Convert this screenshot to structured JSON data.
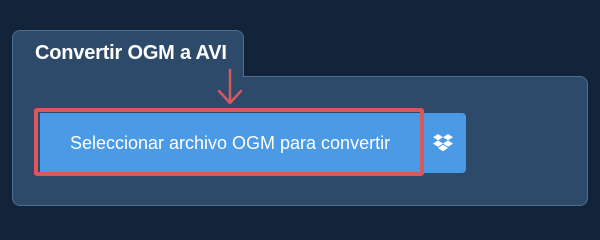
{
  "panel": {
    "title": "Convertir OGM a AVI"
  },
  "buttons": {
    "select_file_label": "Seleccionar archivo OGM para convertir",
    "dropbox_icon": "dropbox-icon"
  },
  "colors": {
    "background": "#13233a",
    "panel": "#2d4a6b",
    "button": "#4a9ae6",
    "highlight": "#d9585c"
  }
}
